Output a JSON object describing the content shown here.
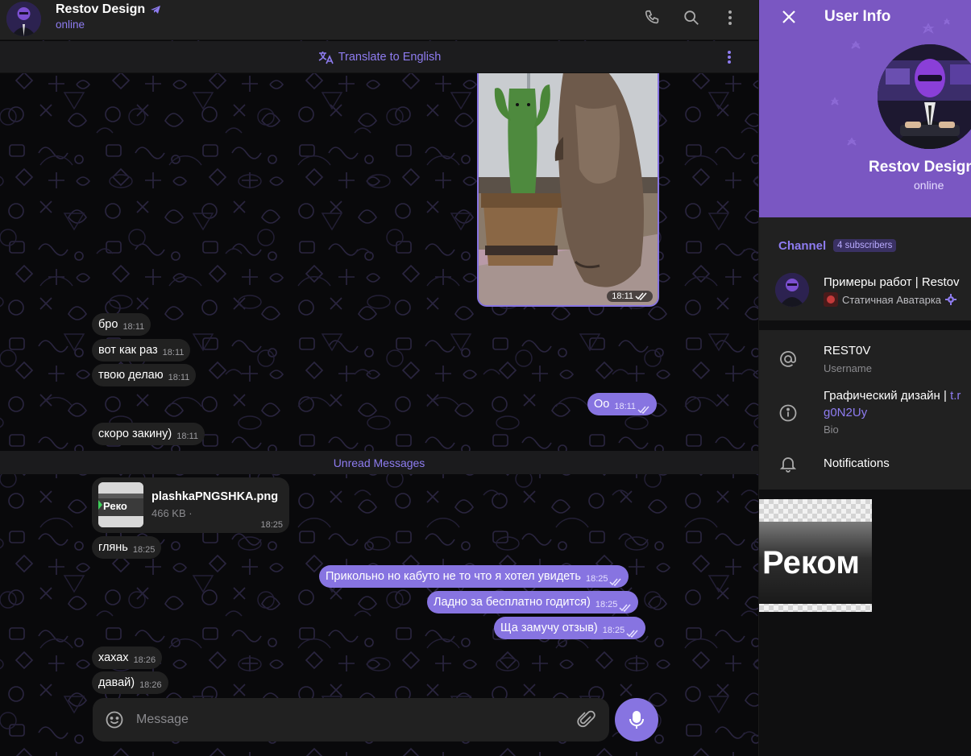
{
  "header": {
    "title": "Restov Design",
    "status": "online"
  },
  "translate": {
    "label": "Translate to English"
  },
  "messages": {
    "photo_time": "18:11",
    "m1": {
      "text": "бро",
      "time": "18:11"
    },
    "m2": {
      "text": "вот как раз",
      "time": "18:11"
    },
    "m3": {
      "text": "твою делаю",
      "time": "18:11"
    },
    "m4": {
      "text": "Оо",
      "time": "18:11"
    },
    "m5": {
      "text": "скоро закину)",
      "time": "18:11"
    },
    "unread": "Unread Messages",
    "file": {
      "name": "plashkaPNGSHKA.png",
      "size": "466 KB ·",
      "time": "18:25",
      "thumb_text": "Реко"
    },
    "m6": {
      "text": "глянь",
      "time": "18:25"
    },
    "m7": {
      "text": "Прикольно но кабуто не то что я хотел увидеть",
      "time": "18:25"
    },
    "m8": {
      "text": "Ладно за бесплатно годится)",
      "time": "18:25"
    },
    "m9": {
      "text": "Ща замучу отзыв)",
      "time": "18:25"
    },
    "m10": {
      "text": "хахах",
      "time": "18:26"
    },
    "m11": {
      "text": "давай)",
      "time": "18:26"
    }
  },
  "composer": {
    "placeholder": "Message"
  },
  "panel": {
    "title": "User Info",
    "name": "Restov Design",
    "status": "online",
    "channel_label": "Channel",
    "subscribers": "4 subscribers",
    "channel_name": "Примеры работ | Restov",
    "channel_sub": "Статичная Аватарка",
    "username": "REST0V",
    "username_label": "Username",
    "bio_text": "Графический дизайн | ",
    "bio_link_part1": "t.r",
    "bio_link_part2": "g0N2Uy",
    "bio_label": "Bio",
    "notifications": "Notifications",
    "media_text": "Реком"
  },
  "colors": {
    "accent": "#8774e1",
    "accent_text": "#8e7cf0",
    "panel_header": "#7a57c2",
    "bubble_in": "#212121"
  }
}
